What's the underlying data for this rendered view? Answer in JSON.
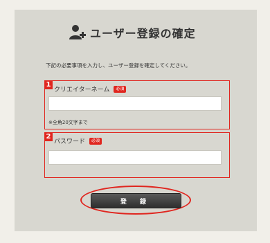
{
  "header": {
    "title": "ユーザー登録の確定",
    "icon": "user-add-icon"
  },
  "description": "下記の必要事項を入力し、ユーザー登録を確定してください。",
  "fields": [
    {
      "number": "1",
      "label": "クリエイターネーム",
      "required_badge": "必須",
      "value": "",
      "note": "※全角20文字まで"
    },
    {
      "number": "2",
      "label": "パスワード",
      "required_badge": "必須",
      "value": ""
    }
  ],
  "submit_label": "登 録",
  "colors": {
    "accent": "#e0261f",
    "panel": "#d8d7d0",
    "page": "#f1efe9",
    "button": "#3a3a3a"
  }
}
